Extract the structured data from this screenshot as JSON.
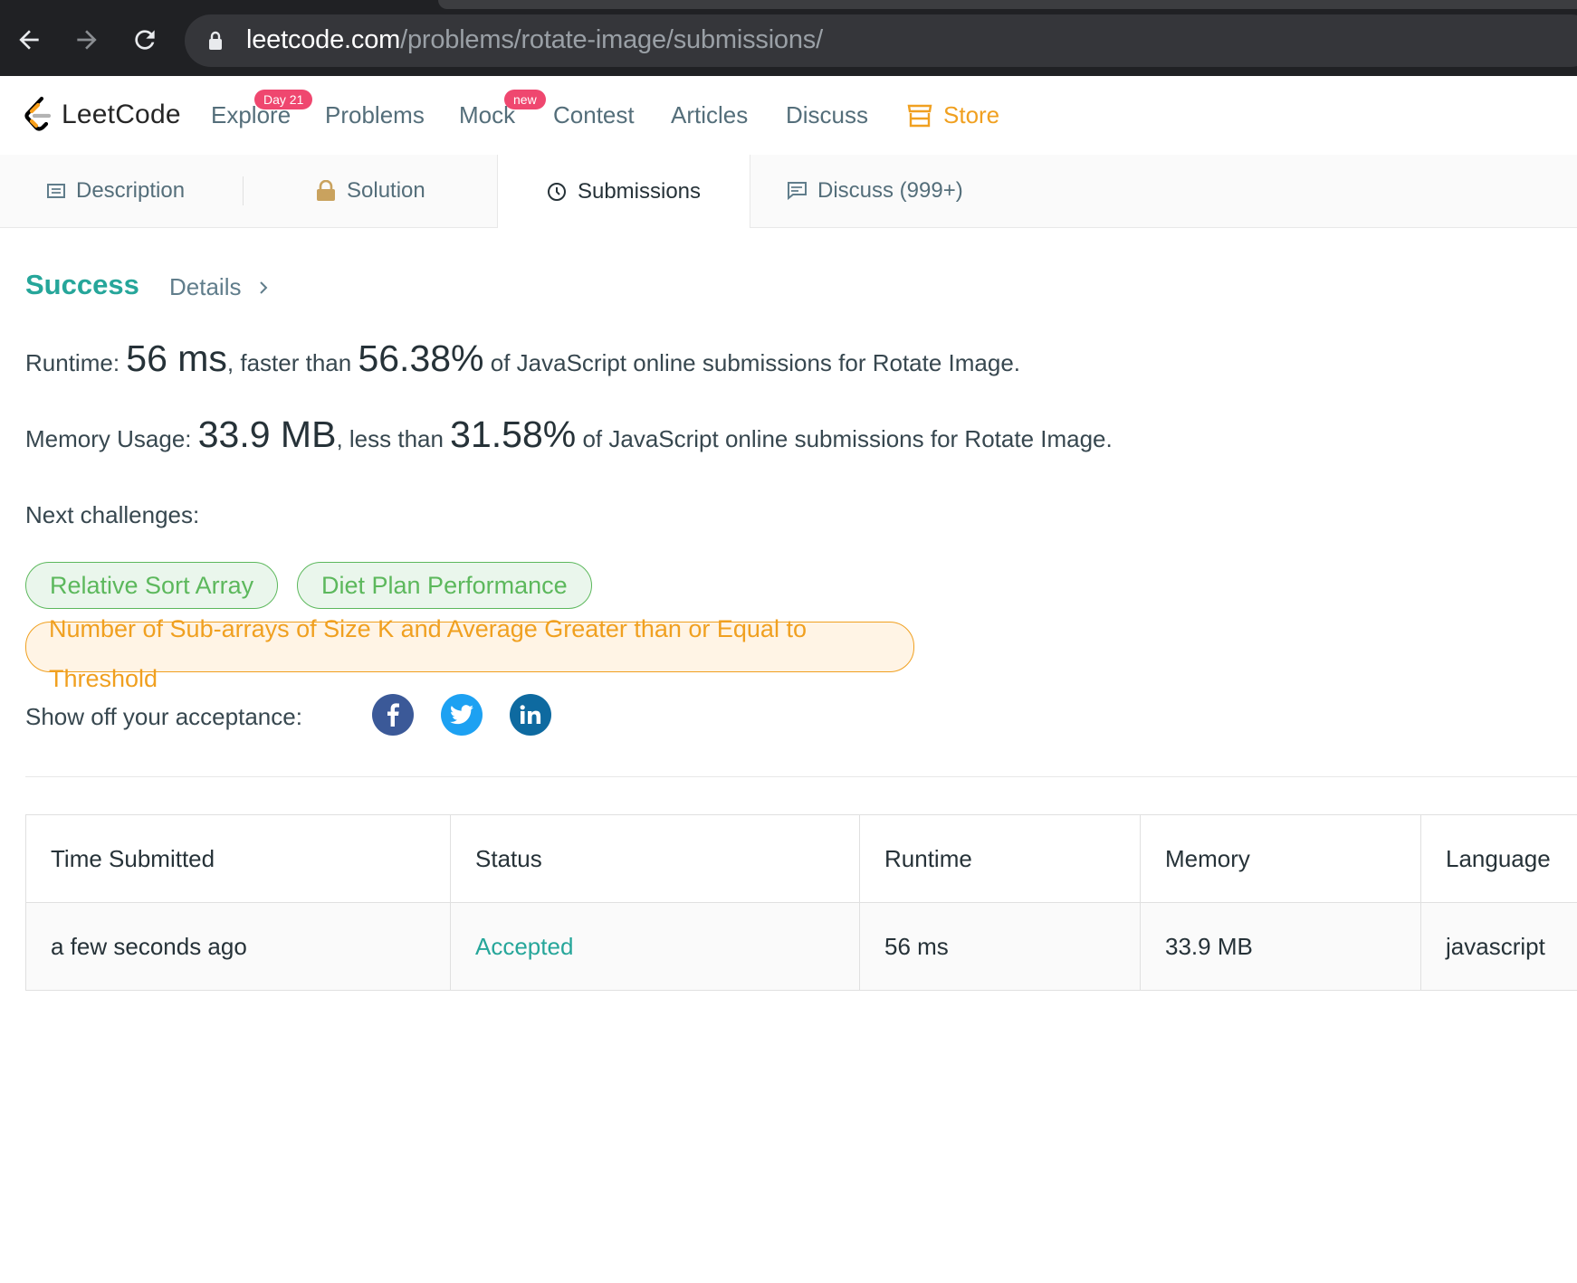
{
  "browser": {
    "url_host": "leetcode.com",
    "url_path": "/problems/rotate-image/submissions/"
  },
  "header": {
    "logo_text": "LeetCode",
    "nav": [
      {
        "label": "Explore",
        "badge": "Day 21"
      },
      {
        "label": "Problems"
      },
      {
        "label": "Mock",
        "badge": "new"
      },
      {
        "label": "Contest"
      },
      {
        "label": "Articles"
      },
      {
        "label": "Discuss"
      },
      {
        "label": "Store"
      }
    ]
  },
  "tabs": [
    {
      "label": "Description"
    },
    {
      "label": "Solution"
    },
    {
      "label": "Submissions",
      "active": true
    },
    {
      "label": "Discuss (999+)"
    }
  ],
  "result": {
    "status": "Success",
    "details": "Details",
    "runtime": {
      "label": "Runtime: ",
      "value": "56 ms",
      "comparison": ", faster than ",
      "percent": "56.38%",
      "suffix": " of JavaScript online submissions for Rotate Image."
    },
    "memory": {
      "label": "Memory Usage: ",
      "value": "33.9 MB",
      "comparison": ", less than ",
      "percent": "31.58%",
      "suffix": " of JavaScript online submissions for Rotate Image."
    }
  },
  "next_challenges": {
    "label": "Next challenges:",
    "items": [
      {
        "title": "Relative Sort Array",
        "difficulty_color": "#5cb85c"
      },
      {
        "title": "Diet Plan Performance",
        "difficulty_color": "#5cb85c"
      },
      {
        "title": "Number of Sub-arrays of Size K and Average Greater than or Equal to Threshold",
        "difficulty_color": "#f0a020"
      }
    ]
  },
  "share": {
    "label": "Show off your acceptance:",
    "networks": [
      "facebook-icon",
      "twitter-icon",
      "linkedin-icon"
    ]
  },
  "submissions_table": {
    "headers": [
      "Time Submitted",
      "Status",
      "Runtime",
      "Memory",
      "Language"
    ],
    "rows": [
      [
        "a few seconds ago",
        "Accepted",
        "56 ms",
        "33.9 MB",
        "javascript"
      ]
    ]
  }
}
